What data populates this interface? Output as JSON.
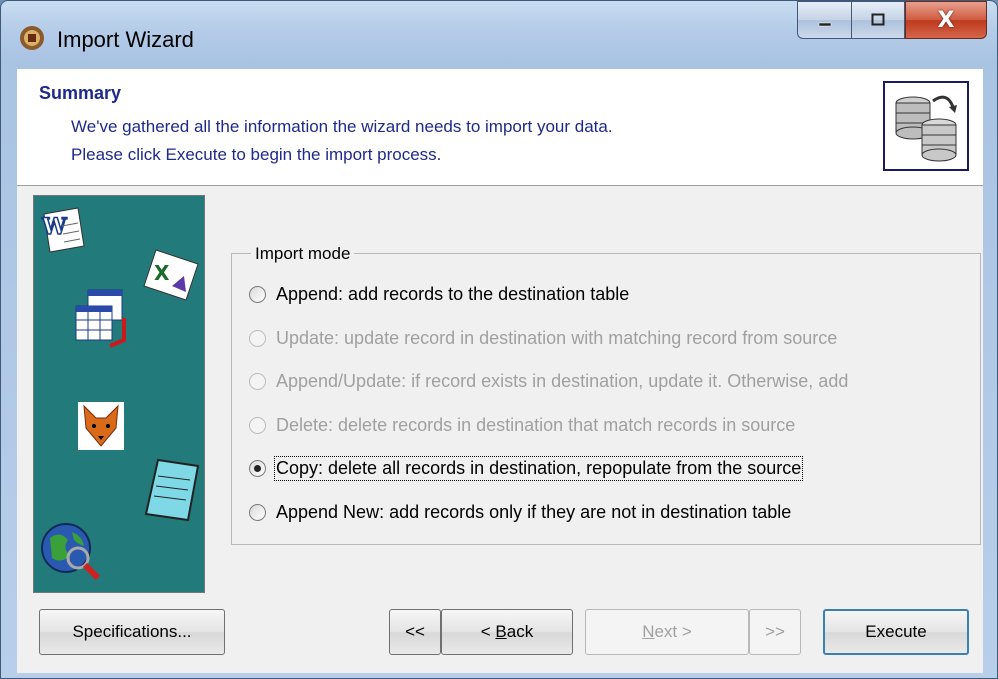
{
  "window": {
    "title": "Import Wizard",
    "close_symbol": "X"
  },
  "header": {
    "title": "Summary",
    "line1": "We've gathered all the information the wizard needs to import your data.",
    "line2": "Please click Execute to begin the import process."
  },
  "import_mode": {
    "label": "Import mode",
    "options": [
      {
        "label": "Append: add records to the destination table",
        "enabled": true,
        "selected": false
      },
      {
        "label": "Update: update record in destination with matching record from source",
        "enabled": false,
        "selected": false
      },
      {
        "label": "Append/Update: if record exists in destination, update it. Otherwise, add",
        "enabled": false,
        "selected": false
      },
      {
        "label": "Delete: delete records in destination that match records in source",
        "enabled": false,
        "selected": false
      },
      {
        "label": "Copy: delete all records in destination, repopulate from the source",
        "enabled": true,
        "selected": true
      },
      {
        "label": "Append New: add records only if they are not in destination table",
        "enabled": true,
        "selected": false
      }
    ]
  },
  "buttons": {
    "specifications": "Specifications...",
    "first": "<<",
    "back_prefix": "< ",
    "back_key": "B",
    "back_rest": "ack",
    "next_key": "N",
    "next_rest": "ext >",
    "last": ">>",
    "execute": "Execute"
  }
}
